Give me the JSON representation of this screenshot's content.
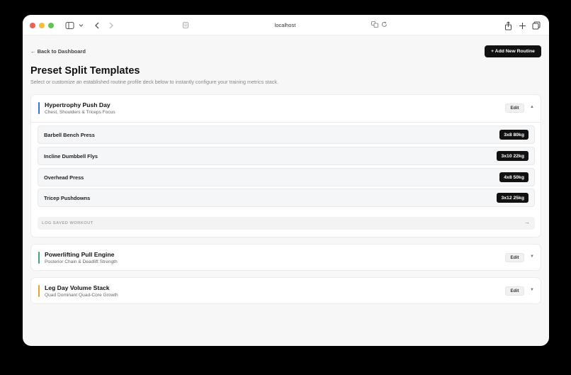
{
  "browser": {
    "url": "localhost"
  },
  "header": {
    "back_link": "← Back to Dashboard",
    "add_button": "+ Add New Routine",
    "title": "Preset Split Templates",
    "subtitle": "Select or customize an established routine profile deck below to instantly configure your training metrics stack."
  },
  "routines": [
    {
      "title": "Hypertrophy Push Day",
      "subtitle": "Chest, Shoulders & Triceps Focus",
      "accent": "#3b6fd8",
      "expanded": true,
      "edit_label": "Edit",
      "chevron": "▲",
      "exercises": [
        {
          "name": "Barbell Bench Press",
          "badge": "3x8 80kg"
        },
        {
          "name": "Incline Dumbbell Flys",
          "badge": "3x10 22kg"
        },
        {
          "name": "Overhead Press",
          "badge": "4x8 50kg"
        },
        {
          "name": "Tricep Pushdowns",
          "badge": "3x12 25kg"
        }
      ],
      "log_label": "LOG SAVED WORKOUT",
      "log_arrow": "→"
    },
    {
      "title": "Powerlifting Pull Engine",
      "subtitle": "Posterior Chain & Deadlift Strength",
      "accent": "#3aaa72",
      "expanded": false,
      "edit_label": "Edit",
      "chevron": "▼"
    },
    {
      "title": "Leg Day Volume Stack",
      "subtitle": "Quad Dominant Quad-Core Growth",
      "accent": "#e0a72e",
      "expanded": false,
      "edit_label": "Edit",
      "chevron": "▼"
    }
  ]
}
